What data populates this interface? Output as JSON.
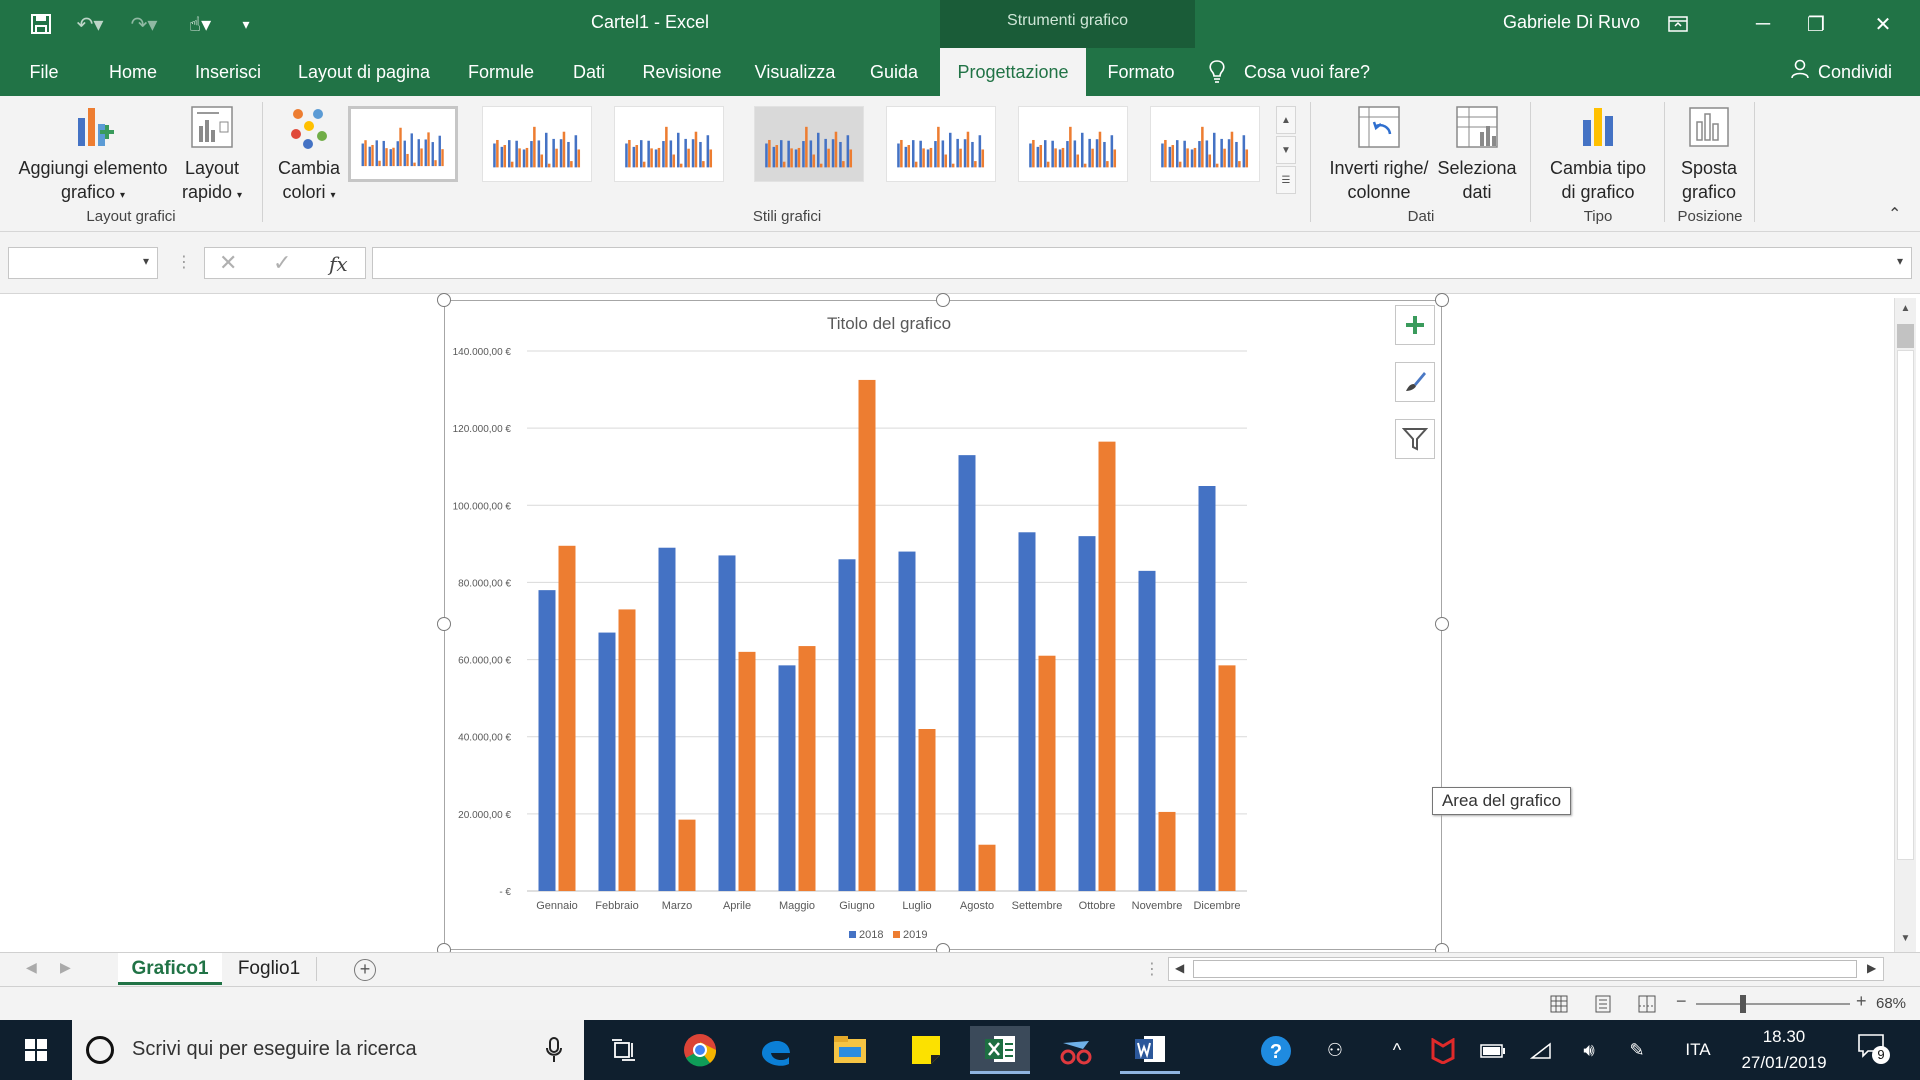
{
  "window": {
    "doc_title": "Cartel1  -  Excel",
    "tools_label": "Strumenti grafico",
    "user": "Gabriele Di Ruvo"
  },
  "tabs": [
    "File",
    "Home",
    "Inserisci",
    "Layout di pagina",
    "Formule",
    "Dati",
    "Revisione",
    "Visualizza",
    "Guida",
    "Progettazione",
    "Formato"
  ],
  "active_tab": "Progettazione",
  "tell_me": "Cosa vuoi fare?",
  "share": "Condividi",
  "ribbon": {
    "add_element_1": "Aggiungi elemento",
    "add_element_2": "grafico",
    "quick_layout_1": "Layout",
    "quick_layout_2": "rapido",
    "group_layout": "Layout grafici",
    "change_colors_1": "Cambia",
    "change_colors_2": "colori",
    "group_styles": "Stili grafici",
    "switch_1": "Inverti righe/",
    "switch_2": "colonne",
    "select_data_1": "Seleziona",
    "select_data_2": "dati",
    "group_data": "Dati",
    "change_type_1": "Cambia tipo",
    "change_type_2": "di grafico",
    "group_type": "Tipo",
    "move_1": "Sposta",
    "move_2": "grafico",
    "group_position": "Posizione"
  },
  "formula_bar": {
    "name_box": "",
    "fx": "fx",
    "formula": ""
  },
  "chart_tooltip": "Area del grafico",
  "chart_data": {
    "type": "bar",
    "title": "Titolo del grafico",
    "categories": [
      "Gennaio",
      "Febbraio",
      "Marzo",
      "Aprile",
      "Maggio",
      "Giugno",
      "Luglio",
      "Agosto",
      "Settembre",
      "Ottobre",
      "Novembre",
      "Dicembre"
    ],
    "series": [
      {
        "name": "2018",
        "color": "#4472c4",
        "values": [
          78000,
          67000,
          89000,
          87000,
          58500,
          86000,
          88000,
          113000,
          93000,
          92000,
          83000,
          105000
        ]
      },
      {
        "name": "2019",
        "color": "#ed7d31",
        "values": [
          89500,
          73000,
          18500,
          62000,
          63500,
          132500,
          42000,
          12000,
          61000,
          116500,
          20500,
          58500
        ]
      }
    ],
    "ylim": [
      0,
      140000
    ],
    "yticks": [
      "-  €",
      "20.000,00 €",
      "40.000,00 €",
      "60.000,00 €",
      "80.000,00 €",
      "100.000,00 €",
      "120.000,00 €",
      "140.000,00 €"
    ],
    "grid": true,
    "legend": "bottom"
  },
  "sheets": [
    "Grafico1",
    "Foglio1"
  ],
  "active_sheet": "Grafico1",
  "zoom": "68%",
  "taskbar": {
    "search_placeholder": "Scrivi qui per eseguire la ricerca",
    "lang": "ITA",
    "time": "18.30",
    "date": "27/01/2019",
    "notifications": "9"
  }
}
